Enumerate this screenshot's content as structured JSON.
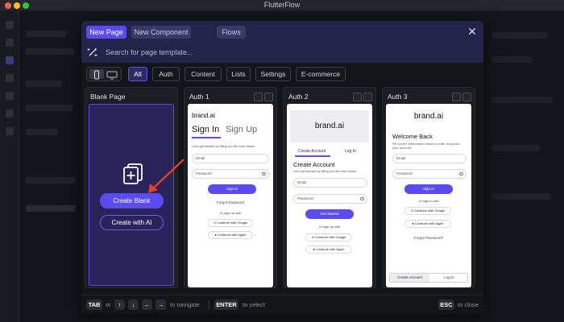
{
  "window": {
    "title": "FlutterFlow"
  },
  "modal": {
    "tabs": [
      {
        "label": "New Page",
        "active": true
      },
      {
        "label": "New Component",
        "active": false
      },
      {
        "label": "Flows",
        "active": false
      }
    ],
    "search": {
      "placeholder": "Search for page template..."
    },
    "filters": [
      {
        "label": "All",
        "active": true
      },
      {
        "label": "Auth",
        "active": false
      },
      {
        "label": "Content",
        "active": false
      },
      {
        "label": "Lists",
        "active": false
      },
      {
        "label": "Settings",
        "active": false
      },
      {
        "label": "E-commerce",
        "active": false
      }
    ],
    "view_modes": [
      "mobile-icon",
      "desktop-icon"
    ]
  },
  "cards": {
    "blank": {
      "title": "Blank Page",
      "create_blank_label": "Create Blank",
      "create_ai_label": "Create with AI"
    },
    "auth1": {
      "title": "Auth 1",
      "brand": "brand.ai",
      "tab_signin": "Sign In",
      "tab_signup": "Sign Up",
      "subtitle": "Let's get started by filling out the form below.",
      "email": "Email",
      "password": "Password",
      "signin_btn": "Sign In",
      "forgot": "Forgot Password",
      "or": "Or sign up with",
      "google": "Continue with Google",
      "apple": "Continue with Apple"
    },
    "auth2": {
      "title": "Auth 2",
      "brand": "brand.ai",
      "seg_create": "Create Account",
      "seg_login": "Log In",
      "heading": "Create Account",
      "subtitle": "Let's get started by filling out the form below.",
      "email": "Email",
      "password": "Password",
      "cta": "Get Started",
      "or": "Or sign up with",
      "google": "Continue with Google",
      "apple": "Continue with Apple"
    },
    "auth3": {
      "title": "Auth 3",
      "brand": "brand.ai",
      "heading": "Welcome Back",
      "subtitle": "Fill out the information below in order to access your account.",
      "email": "Email",
      "password": "Password",
      "signin_btn": "Sign In",
      "or": "Or sign in with",
      "google": "Continue with Google",
      "apple": "Continue with Apple",
      "forgot": "Forgot Password?",
      "tab_create": "Create Account",
      "tab_login": "Log In"
    }
  },
  "footer": {
    "tab_key": "TAB",
    "or": "or",
    "arrows": [
      "↑",
      "↓",
      "←",
      "→"
    ],
    "navigate": "to navigate",
    "enter_key": "ENTER",
    "select": "to select",
    "esc_key": "ESC",
    "close": "to close"
  },
  "colors": {
    "accent": "#5b4bf0",
    "header_bg": "#24234a"
  }
}
